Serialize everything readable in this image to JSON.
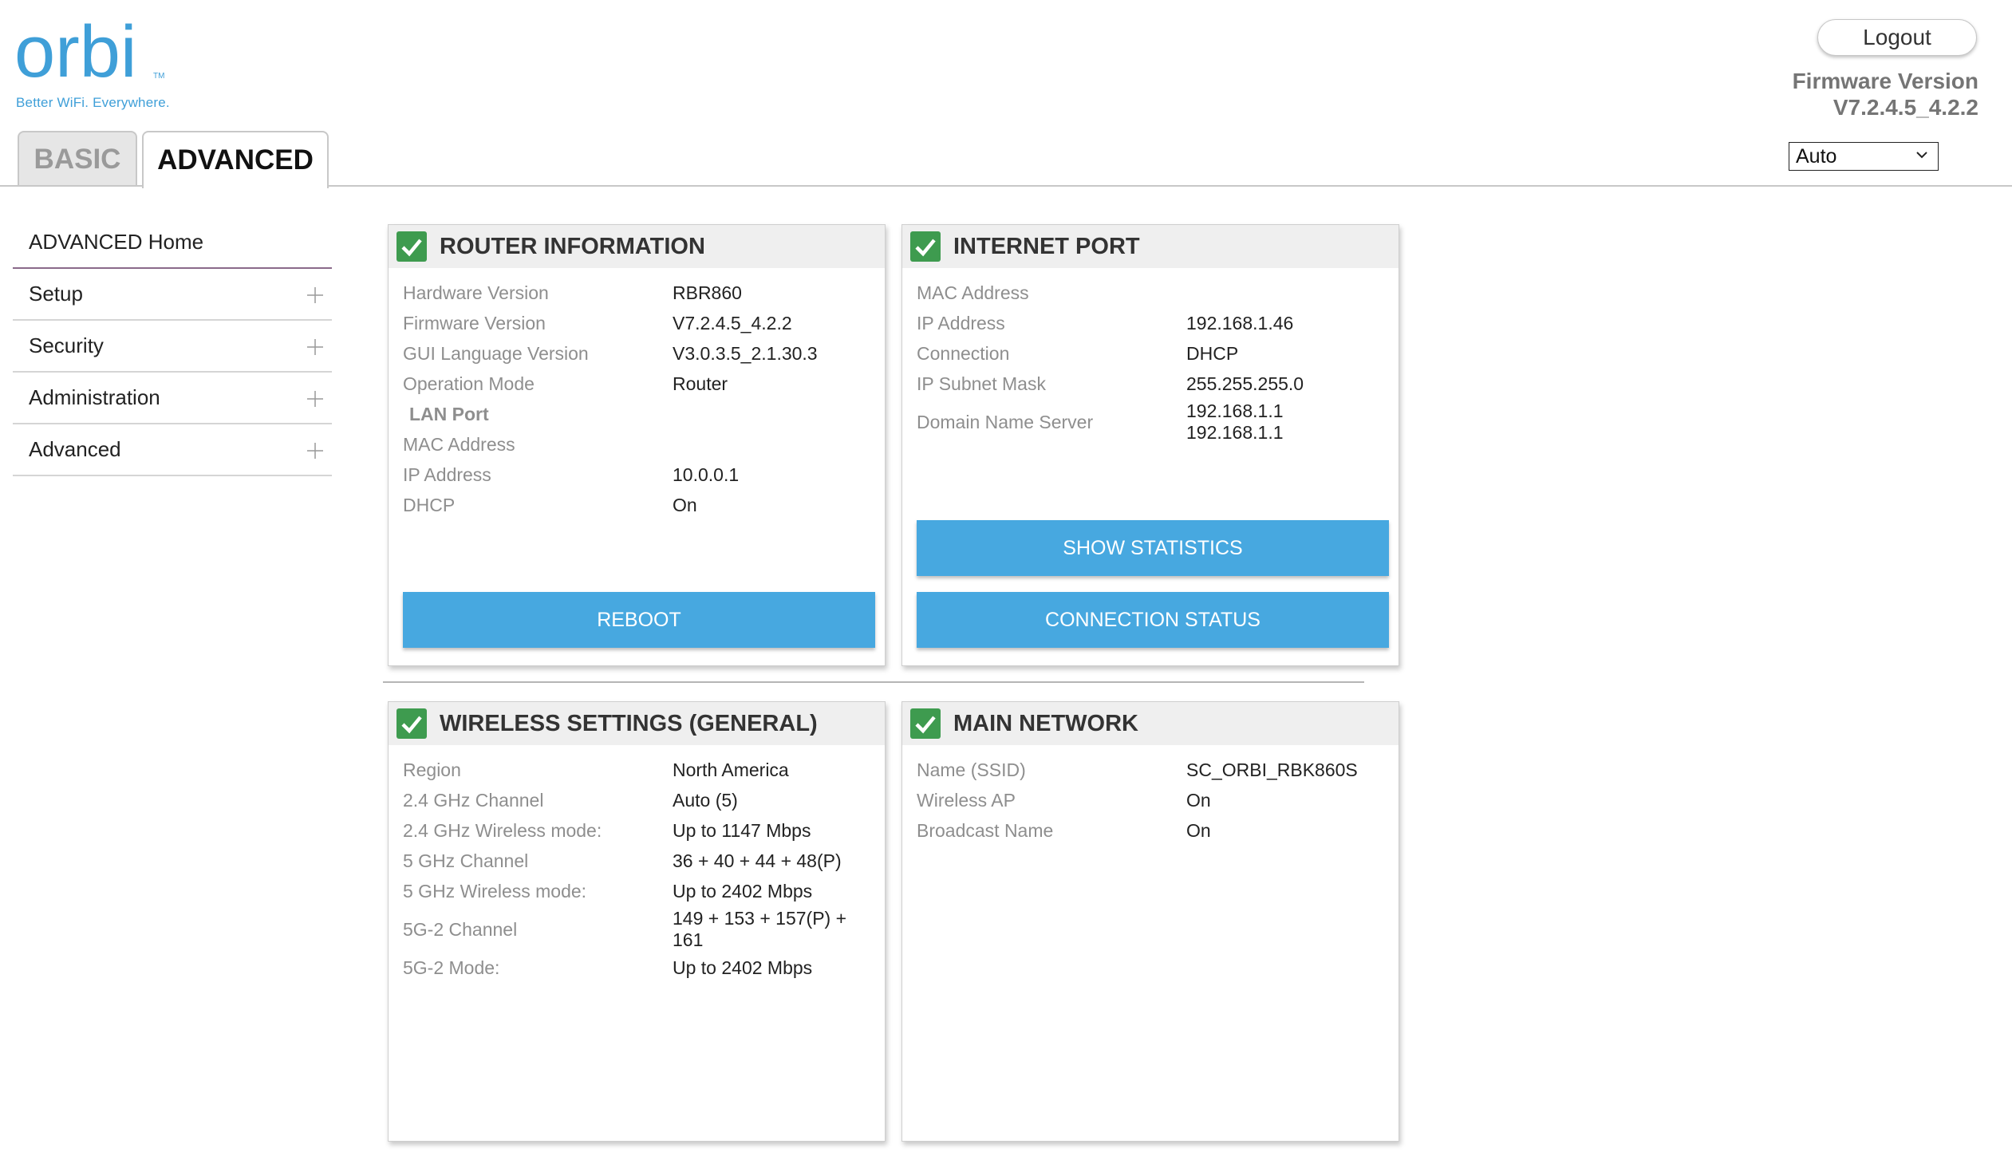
{
  "branding": {
    "logo_text": "orbi",
    "tagline": "Better WiFi. Everywhere."
  },
  "tabs": [
    {
      "label": "BASIC",
      "active": false
    },
    {
      "label": "ADVANCED",
      "active": true
    }
  ],
  "header": {
    "logout_label": "Logout",
    "firmware_label": "Firmware Version",
    "firmware_value": "V7.2.4.5_4.2.2",
    "language_selected": "Auto"
  },
  "sidebar": {
    "items": [
      {
        "label": "ADVANCED Home",
        "expandable": false
      },
      {
        "label": "Setup",
        "expandable": true
      },
      {
        "label": "Security",
        "expandable": true
      },
      {
        "label": "Administration",
        "expandable": true
      },
      {
        "label": "Advanced",
        "expandable": true
      }
    ]
  },
  "router_info": {
    "title": "ROUTER INFORMATION",
    "rows": [
      {
        "label": "Hardware Version",
        "value": "RBR860"
      },
      {
        "label": "Firmware Version",
        "value": "V7.2.4.5_4.2.2"
      },
      {
        "label": "GUI Language Version",
        "value": "V3.0.3.5_2.1.30.3"
      },
      {
        "label": "Operation Mode",
        "value": "Router"
      },
      {
        "label": "LAN Port",
        "value": ""
      },
      {
        "label": "MAC Address",
        "value": ""
      },
      {
        "label": "IP Address",
        "value": "10.0.0.1"
      },
      {
        "label": "DHCP",
        "value": "On"
      }
    ],
    "button_label": "REBOOT"
  },
  "internet_port": {
    "title": "INTERNET PORT",
    "rows": [
      {
        "label": "MAC Address",
        "value": ""
      },
      {
        "label": "IP Address",
        "value": "192.168.1.46"
      },
      {
        "label": "Connection",
        "value": "DHCP"
      },
      {
        "label": "IP Subnet Mask",
        "value": "255.255.255.0"
      },
      {
        "label": "Domain Name Server",
        "value": "192.168.1.1",
        "value2": "192.168.1.1"
      }
    ],
    "stats_button_label": "SHOW STATISTICS",
    "status_button_label": "CONNECTION STATUS"
  },
  "wireless": {
    "title": "WIRELESS SETTINGS (GENERAL)",
    "rows": [
      {
        "label": "Region",
        "value": "North America"
      },
      {
        "label": "2.4 GHz Channel",
        "value": "Auto (5)"
      },
      {
        "label": "2.4 GHz Wireless mode:",
        "value": "Up to 1147 Mbps"
      },
      {
        "label": "5 GHz Channel",
        "value": "36 + 40 + 44 + 48(P)"
      },
      {
        "label": "5 GHz Wireless mode:",
        "value": "Up to 2402 Mbps"
      },
      {
        "label": "5G-2 Channel",
        "value": "149 + 153 + 157(P) +",
        "value2": "161"
      },
      {
        "label": "5G-2 Mode:",
        "value": "Up to 2402 Mbps"
      }
    ]
  },
  "main_network": {
    "title": "MAIN NETWORK",
    "rows": [
      {
        "label": "Name (SSID)",
        "value": "SC_ORBI_RBK860S"
      },
      {
        "label": "Wireless AP",
        "value": "On"
      },
      {
        "label": "Broadcast Name",
        "value": "On"
      }
    ]
  },
  "colors": {
    "accent_blue": "#47a8e0",
    "check_green": "#3e9b4f",
    "logo_blue": "#3f9fd8"
  }
}
